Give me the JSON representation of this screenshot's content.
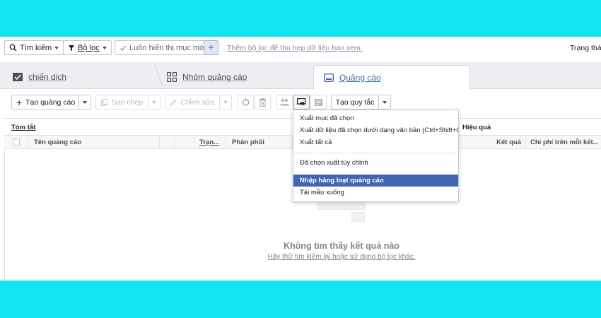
{
  "filterbar": {
    "search_label": "Tìm kiếm",
    "filter_label": "Bộ lọc",
    "always_show_label": "Luôn hiển thị mục mới",
    "add_label": "+",
    "hint": "Thêm bộ lọc để thu hẹp dữ liệu bạn xem.",
    "status_label": "Trạng thái:"
  },
  "tabs": [
    {
      "label": "chiến dịch",
      "icon": "checkbox-icon"
    },
    {
      "label": "Nhóm quảng cáo",
      "icon": "grid-icon"
    },
    {
      "label": "Quảng cáo",
      "icon": "ad-icon",
      "active": true
    }
  ],
  "actionbar": {
    "create_ad": "Tạo quảng cáo",
    "copy": "Sao chép",
    "edit": "Chỉnh sửa",
    "create_rule": "Tạo quy tắc"
  },
  "table": {
    "summary_label": "Tóm tắt",
    "performance_label": "Hiệu quả",
    "columns": [
      "Tên quảng cáo",
      "Trạn...",
      "Phân phối",
      "Kết quả",
      "Chi phí trên mỗi kết..."
    ]
  },
  "empty": {
    "title": "Không tìm thấy kết quả nào",
    "subtitle": "Hãy thử tìm kiếm lại hoặc sử dụng bộ lọc khác."
  },
  "dropdown": {
    "items": [
      "Xuất mục đã chọn",
      "Xuất dữ liệu đã chọn dưới dạng văn bản (Ctrl+Shift+C)",
      "Xuất tất cả",
      "Đã chọn xuất tùy chỉnh",
      "Nhập hàng loạt quảng cáo",
      "Tải mẫu xuống"
    ],
    "selected": "Nhập hàng loạt quảng cáo"
  },
  "colors": {
    "frame": "#15e4f1",
    "accent": "#4267b2",
    "tab_bg": "#eceef2"
  }
}
